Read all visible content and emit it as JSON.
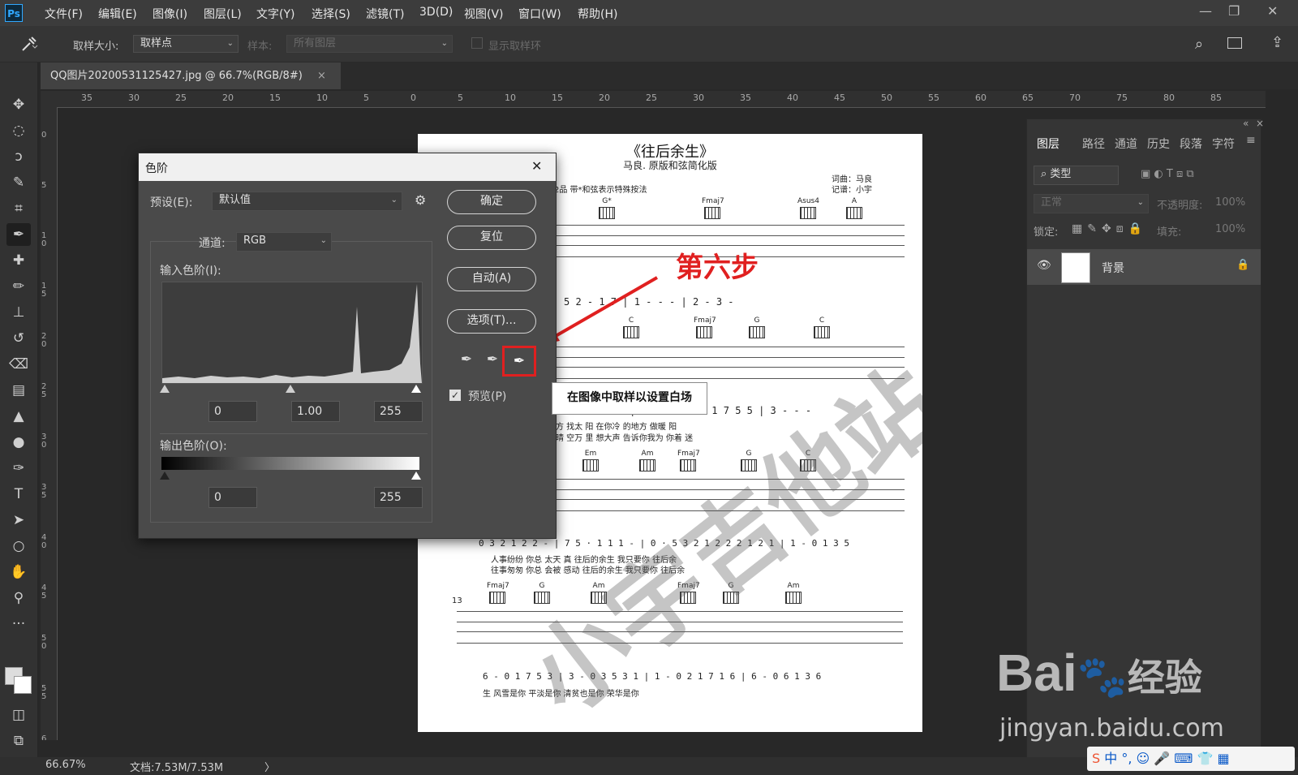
{
  "app": {
    "logo": "Ps"
  },
  "menu": [
    "文件(F)",
    "编辑(E)",
    "图像(I)",
    "图层(L)",
    "文字(Y)",
    "选择(S)",
    "滤镜(T)",
    "3D(D)",
    "视图(V)",
    "窗口(W)",
    "帮助(H)"
  ],
  "window_controls": {
    "minimize": "—",
    "restore": "❐",
    "close": "✕"
  },
  "options": {
    "sample_size_label": "取样大小:",
    "sample_size_value": "取样点",
    "sample_label": "样本:",
    "sample_value": "所有图层",
    "show_ring_label": "显示取样环"
  },
  "document_tab": {
    "title": "QQ图片20200531125427.jpg @ 66.7%(RGB/8#)",
    "close": "×"
  },
  "ruler_h": [
    "35",
    "30",
    "25",
    "20",
    "15",
    "10",
    "5",
    "0",
    "5",
    "10",
    "15",
    "20",
    "25",
    "30",
    "35",
    "40",
    "45",
    "50",
    "55",
    "60",
    "65",
    "70",
    "75",
    "80",
    "85"
  ],
  "ruler_v": [
    "0",
    "5",
    "1 0",
    "1 5",
    "2 0",
    "2 5",
    "3 0",
    "3 5",
    "4 0",
    "4 5",
    "5 0",
    "5 5",
    "6 0"
  ],
  "sheet": {
    "title": "《往后余生》",
    "subtitle": "马良. 原版和弦简化版",
    "credit1": "词曲：马良",
    "credit2": "记谱：小宇",
    "note": "夹2品  带*和弦表示特殊按法",
    "chords1": [
      "G*",
      "Fmaj7",
      "Asus4",
      "A"
    ],
    "chords2": [
      "C",
      "Fmaj7",
      "G",
      "C"
    ],
    "chords3": [
      "Em",
      "Am",
      "Fmaj7",
      "G",
      "C"
    ],
    "chords4": [
      "Fmaj7",
      "G",
      "Am",
      "Fmaj7",
      "G",
      "Am"
    ],
    "row1": "5   2  -  1 7 | 1  -  -  -  | 2  -  3  -",
    "row2": "2 1 7 1 5  5  -  | 5 3 3 3 2 1 1 7 5 5 | 3  -  -  -",
    "lyr2a": "地方 找太 阳          在你冷 的地方   做暖     阳",
    "lyr2b": "看晴 空万 里          想大声 告诉你我为 你着     迷",
    "row3": "0  3 2 1 2 2  -  | 7 5 · 1 1 1  - | 0 · 5 3 2 1 2 2   2 1 2 1 | 1  -  0 1 3 5",
    "lyr3a": "人事纷纷         你总  太天 真          往后的余生       我只要你             往后余",
    "lyr3b": "往事匆匆         你总  会被 感动        往后的余生       我只要你             往后余",
    "measure": "13",
    "row4": "6  -  0 1 7 5 3 | 3  -  0 3 5 3 1 | 1  -  0 2 1 7 1 6 | 6  -  0 6 1 3 6",
    "lyr4": "生          风雪是你              平淡是你                清贫也是你                荣华是你",
    "watermark": "小宇吉他站"
  },
  "levels_dialog": {
    "title": "色阶",
    "close": "✕",
    "preset_label": "预设(E):",
    "preset_value": "默认值",
    "channel_label": "通道:",
    "channel_value": "RGB",
    "input_label": "输入色阶(I):",
    "input_black": "0",
    "input_gamma": "1.00",
    "input_white": "255",
    "output_label": "输出色阶(O):",
    "output_black": "0",
    "output_white": "255",
    "ok": "确定",
    "reset": "复位",
    "auto": "自动(A)",
    "options": "选项(T)...",
    "preview_label": "预览(P)",
    "preview_checked": true
  },
  "tooltip": "在图像中取样以设置白场",
  "annotation": "第六步",
  "layers_panel": {
    "tabs": [
      "图层",
      "路径",
      "通道",
      "历史",
      "段落",
      "字符"
    ],
    "filter_placeholder": "类型",
    "blend_mode": "正常",
    "opacity_label": "不透明度:",
    "opacity_value": "100%",
    "lock_label": "锁定:",
    "fill_label": "填充:",
    "fill_value": "100%",
    "layer_name": "背景"
  },
  "status": {
    "zoom": "66.67%",
    "doc_info": "文档:7.53M/7.53M",
    "arrow": "〉"
  },
  "baidu_watermark": {
    "logo": "Bai",
    "logo2": "经验",
    "url": "jingyan.baidu.com"
  },
  "colors": {
    "accent_red": "#e02020",
    "ps_blue": "#31a8ff",
    "panel": "#353535"
  }
}
